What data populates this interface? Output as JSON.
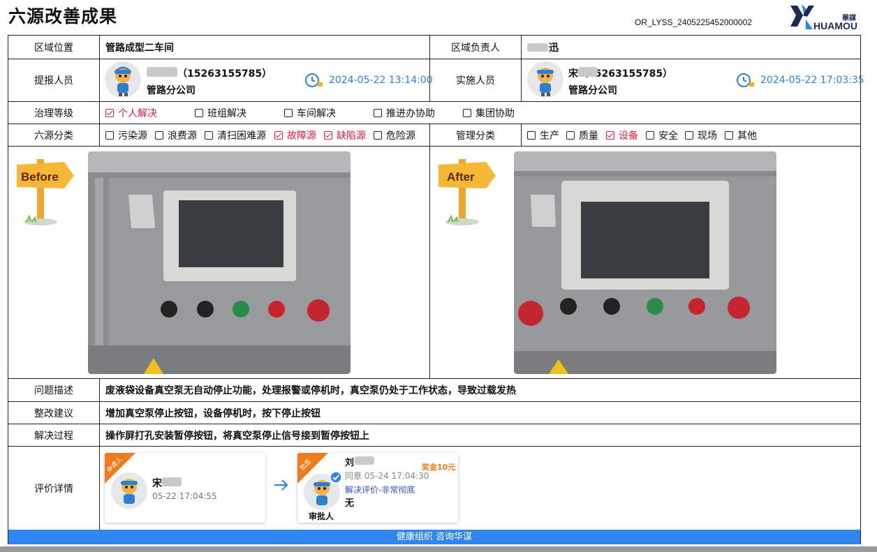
{
  "header": {
    "title": "六源改善成果",
    "doc_id": "OR_LYSS_2405225452000002",
    "logo_cn": "華謀",
    "logo_en": "HUAMOU"
  },
  "rows": {
    "area_label": "区域位置",
    "area_value": "管路成型二车间",
    "owner_label": "区域负责人",
    "owner_value": "迅",
    "proposer_label": "提报人员",
    "proposer_name": "（15263155785）",
    "proposer_dept": "管路分公司",
    "proposer_time": "2024-05-22 13:14:00",
    "implementer_label": "实施人员",
    "implementer_name": "宋（15263155785）",
    "implementer_dept": "管路分公司",
    "implementer_time": "2024-05-22 17:03:35",
    "level_label": "治理等级",
    "source_label": "六源分类",
    "mgmt_label": "管理分类",
    "problem_label": "问题描述",
    "problem_value": "废液袋设备真空泵无自动停止功能，处理报警或停机时，真空泵仍处于工作状态，导致过载发热",
    "suggest_label": "整改建议",
    "suggest_value": "增加真空泵停止按钮，设备停机时，按下停止按钮",
    "process_label": "解决过程",
    "process_value": "操作屏打孔安装暂停按钮，将真空泵停止信号接到暂停按钮上",
    "eval_label": "评价详情"
  },
  "levels": [
    {
      "label": "个人解决",
      "checked": true
    },
    {
      "label": "班组解决",
      "checked": false
    },
    {
      "label": "车间解决",
      "checked": false
    },
    {
      "label": "推进办协助",
      "checked": false
    },
    {
      "label": "集团协助",
      "checked": false
    }
  ],
  "sources": [
    {
      "label": "污染源",
      "checked": false
    },
    {
      "label": "浪费源",
      "checked": false
    },
    {
      "label": "清扫困难源",
      "checked": false
    },
    {
      "label": "故障源",
      "checked": true
    },
    {
      "label": "缺陷源",
      "checked": true
    },
    {
      "label": "危险源",
      "checked": false
    }
  ],
  "mgmt": [
    {
      "label": "生产",
      "checked": false
    },
    {
      "label": "质量",
      "checked": false
    },
    {
      "label": "设备",
      "checked": true
    },
    {
      "label": "安全",
      "checked": false
    },
    {
      "label": "现场",
      "checked": false
    },
    {
      "label": "其他",
      "checked": false
    }
  ],
  "photos": {
    "before_label": "Before",
    "after_label": "After"
  },
  "evaluation": {
    "applicant": {
      "ribbon": "申请人",
      "name": "宋",
      "time": "05-22 17:04:55"
    },
    "approver": {
      "ribbon": "批签",
      "name": "刘",
      "status": "同意 05-24 17:04:30",
      "bonus": "奖金10元",
      "comment": "解决评价-非常彻底",
      "note": "无",
      "role": "审批人"
    }
  },
  "footer": {
    "text": "健康组织 咨询华谋"
  },
  "colors": {
    "accent_blue": "#2f86ee",
    "checked_red": "#e6193c",
    "time_blue": "#2d7fe0",
    "ribbon_orange": "#f07b1d"
  }
}
